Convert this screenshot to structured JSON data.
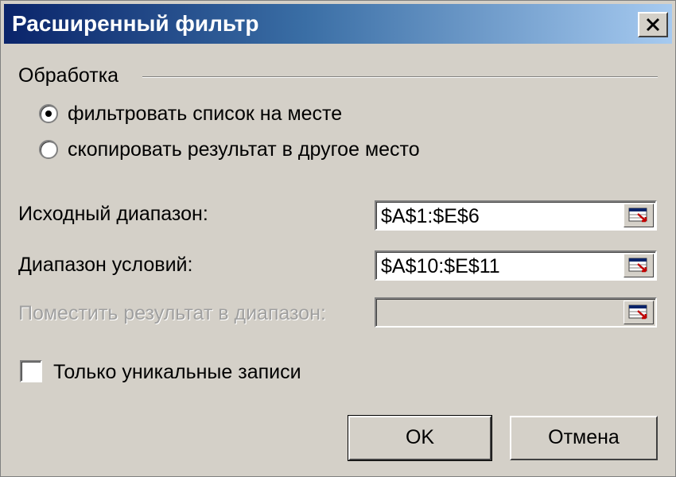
{
  "window": {
    "title": "Расширенный фильтр",
    "close_icon": "close-icon"
  },
  "processing": {
    "group_label": "Обработка",
    "options": [
      {
        "label": "фильтровать список на месте",
        "selected": true
      },
      {
        "label": "скопировать результат в другое место",
        "selected": false
      }
    ]
  },
  "fields": {
    "source_range": {
      "label": "Исходный диапазон:",
      "value": "$A$1:$E$6",
      "enabled": true
    },
    "criteria_range": {
      "label": "Диапазон условий:",
      "value": "$A$10:$E$11",
      "enabled": true
    },
    "copy_to": {
      "label": "Поместить результат в диапазон:",
      "value": "",
      "enabled": false
    }
  },
  "unique": {
    "label": "Только уникальные записи",
    "checked": false
  },
  "buttons": {
    "ok": "OK",
    "cancel": "Отмена"
  }
}
